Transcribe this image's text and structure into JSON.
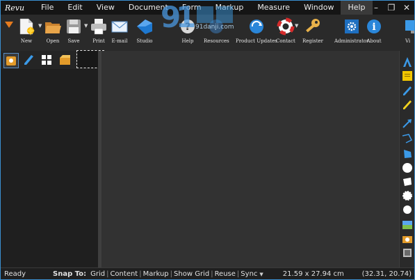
{
  "app": {
    "logo_text": "Revu"
  },
  "menu": {
    "items": [
      "File",
      "Edit",
      "View",
      "Document",
      "Form",
      "Markup",
      "Measure",
      "Window",
      "Help"
    ],
    "active_index": 8
  },
  "window_controls": {
    "minimize": "–",
    "restore": "❐",
    "close": "✕"
  },
  "watermark": {
    "text": "91danji.com"
  },
  "toolbar": {
    "buttons": [
      {
        "name": "menu-arrow",
        "label": ""
      },
      {
        "name": "new",
        "label": "New"
      },
      {
        "name": "open",
        "label": "Open"
      },
      {
        "name": "save",
        "label": "Save"
      },
      {
        "name": "print",
        "label": "Print"
      },
      {
        "name": "email",
        "label": "E-mail"
      },
      {
        "name": "studio",
        "label": "Studio"
      },
      {
        "name": "help",
        "label": "Help"
      },
      {
        "name": "resources",
        "label": "Resources"
      },
      {
        "name": "product-updates",
        "label": "Product Updates"
      },
      {
        "name": "contact",
        "label": "Contact"
      },
      {
        "name": "register",
        "label": "Register"
      },
      {
        "name": "administrator",
        "label": "Administrator"
      },
      {
        "name": "about",
        "label": "About"
      },
      {
        "name": "view",
        "label": "Vi"
      }
    ]
  },
  "statusbar": {
    "ready": "Ready",
    "snap_to_label": "Snap To:",
    "snap_items": [
      "Grid",
      "Content",
      "Markup",
      "Show Grid",
      "Reuse",
      "Sync"
    ],
    "dimensions": "21.59 x 27.94 cm",
    "coordinates": "(32.31, 20.74)"
  },
  "colors": {
    "accent": "#3a8fd0",
    "background": "#2b2b2b",
    "canvas": "#323232"
  }
}
